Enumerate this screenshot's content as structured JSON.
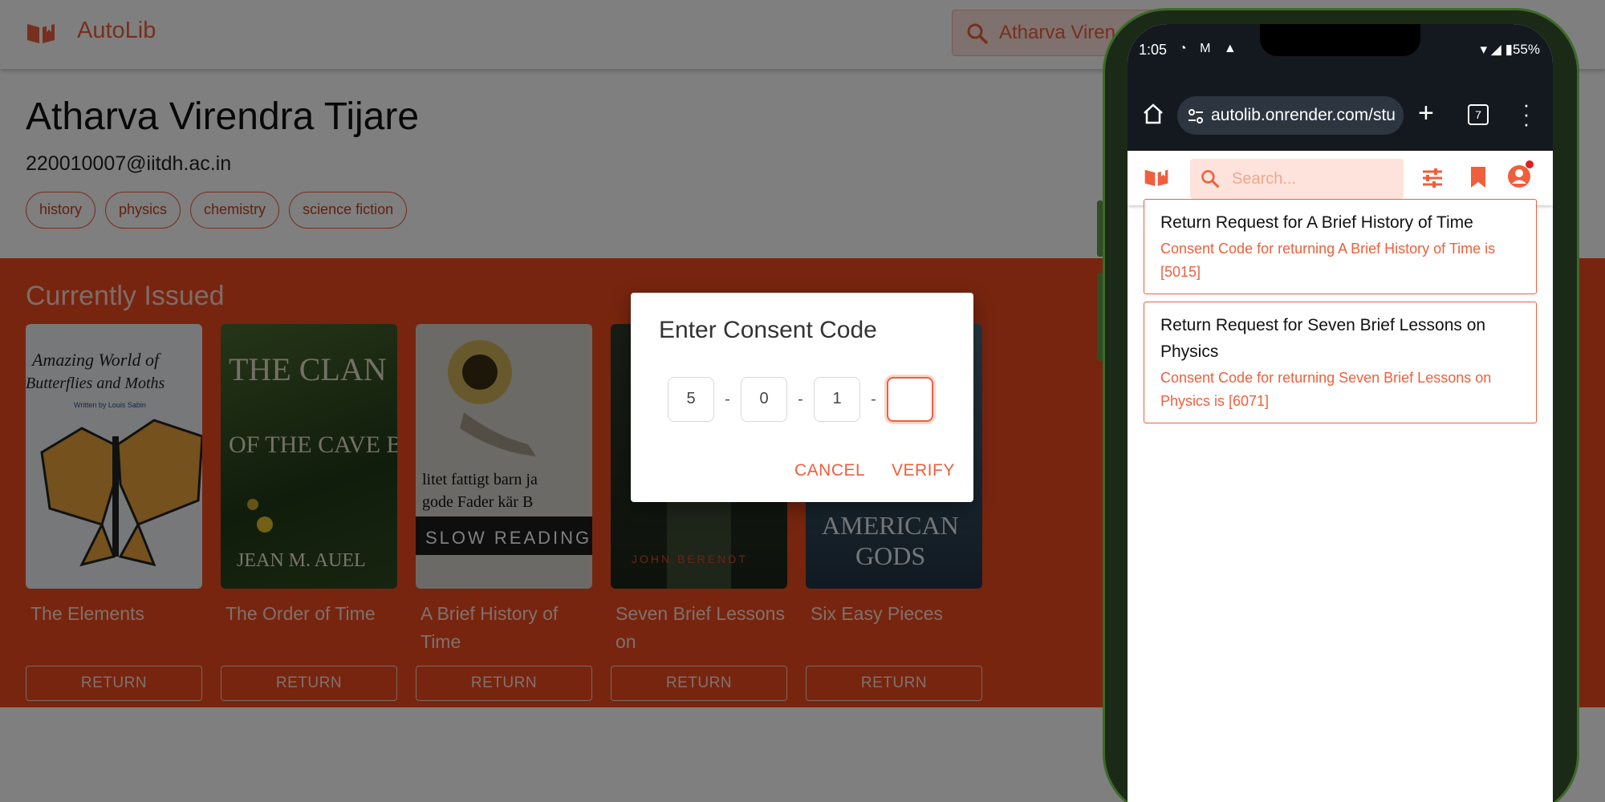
{
  "app": {
    "brand": "AutoLib",
    "search_value": "Atharva Viren",
    "profile": {
      "name": "Atharva Virendra Tijare",
      "email": "220010007@iitdh.ac.in",
      "tags": [
        "history",
        "physics",
        "chemistry",
        "science fiction"
      ]
    },
    "issued": {
      "title": "Currently Issued",
      "books": [
        {
          "title": "The Elements",
          "button": "RETURN"
        },
        {
          "title": "The Order of Time",
          "button": "RETURN"
        },
        {
          "title": "A Brief History of Time",
          "button": "RETURN"
        },
        {
          "title": "Seven Brief Lessons on",
          "button": "RETURN"
        },
        {
          "title": "Six Easy Pieces",
          "button": "RETURN"
        }
      ],
      "covers": [
        {
          "text1": "Amazing World of",
          "text2": "Butterflies and Moths",
          "text3": "Written by Louis Sabin"
        },
        {
          "text1": "THE CLAN",
          "text2": "OF THE CAVE BEAR",
          "text3": "JEAN M. AUEL"
        },
        {
          "text1": "litet fattigt barn ja",
          "text2": "gode Fader kär B",
          "text3": "SLOW READING"
        },
        {
          "text1": "JOHN BERENDT"
        },
        {
          "text1": "AMERICAN",
          "text2": "GODS"
        }
      ]
    }
  },
  "dialog": {
    "title": "Enter Consent Code",
    "digits": [
      "5",
      "0",
      "1",
      ""
    ],
    "separator": "-",
    "cancel_label": "CANCEL",
    "verify_label": "VERIFY"
  },
  "phone": {
    "status": {
      "time": "1:05",
      "battery": "55%"
    },
    "url": "autolib.onrender.com/stu",
    "tab_count": "7",
    "search_placeholder": "Search...",
    "notifications": [
      {
        "title": "Return Request for A Brief History of Time",
        "body": "Consent Code for returning A Brief History of Time is [5015]"
      },
      {
        "title": "Return Request for Seven Brief Lessons on Physics",
        "body": "Consent Code for returning Seven Brief Lessons on Physics is [6071]"
      }
    ]
  },
  "colors": {
    "accent": "#ef5f3c",
    "issued_bg": "#ef4a1f",
    "search_bg": "#fde3dc"
  }
}
